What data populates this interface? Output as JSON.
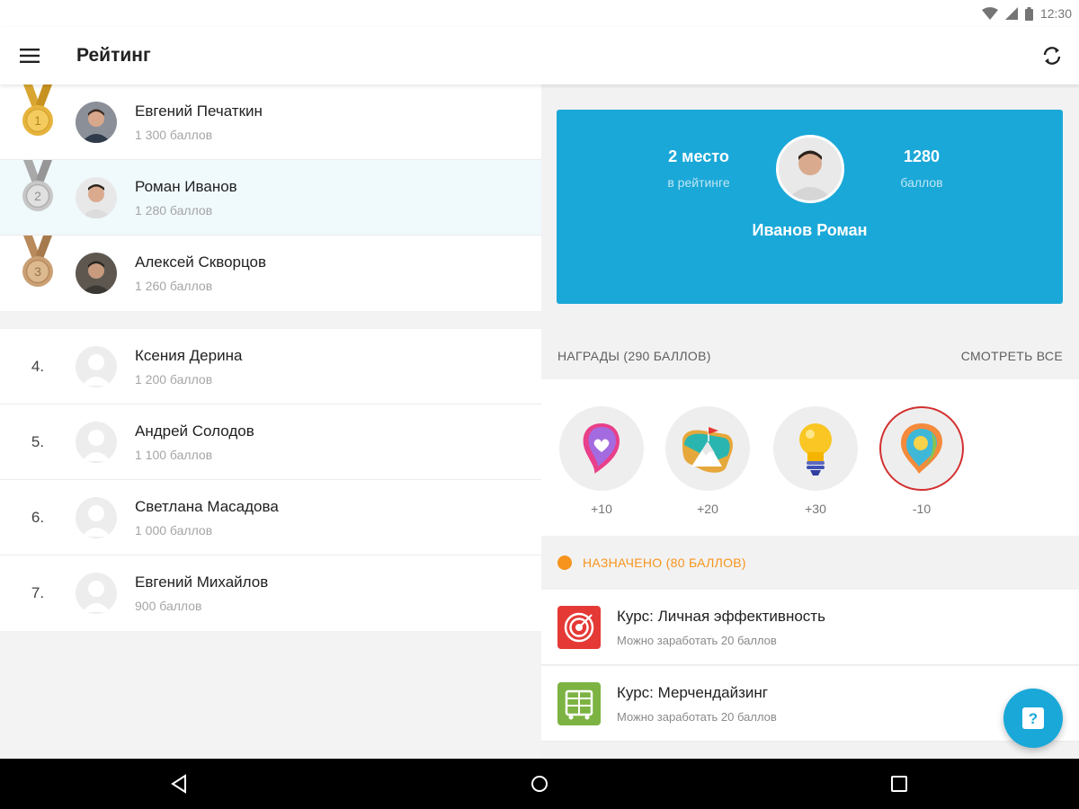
{
  "status_bar": {
    "time": "12:30"
  },
  "app_bar": {
    "title": "Рейтинг"
  },
  "leaderboard": {
    "top": [
      {
        "rank": "1",
        "name": "Евгений Печаткин",
        "score": "1 300 баллов",
        "medal": "gold"
      },
      {
        "rank": "2",
        "name": "Роман Иванов",
        "score": "1 280 баллов",
        "medal": "silver"
      },
      {
        "rank": "3",
        "name": "Алексей Скворцов",
        "score": "1 260 баллов",
        "medal": "bronze"
      }
    ],
    "rest": [
      {
        "rank": "4.",
        "name": "Ксения Дерина",
        "score": "1 200 баллов"
      },
      {
        "rank": "5.",
        "name": "Андрей Солодов",
        "score": "1 100 баллов"
      },
      {
        "rank": "6.",
        "name": "Светлана Масадова",
        "score": "1 000 баллов"
      },
      {
        "rank": "7.",
        "name": "Евгений Михайлов",
        "score": "900 баллов"
      }
    ]
  },
  "profile": {
    "place": "2 место",
    "place_caption": "в рейтинге",
    "points": "1280",
    "points_caption": "баллов",
    "name": "Иванов Роман"
  },
  "awards": {
    "header": "НАГРАДЫ (290 БАЛЛОВ)",
    "see_all": "СМОТРЕТЬ ВСЕ",
    "items": [
      {
        "icon": "heart-pin-icon",
        "points": "+10"
      },
      {
        "icon": "mountain-flag-icon",
        "points": "+20"
      },
      {
        "icon": "lightbulb-icon",
        "points": "+30"
      },
      {
        "icon": "map-pin-icon",
        "points": "-10"
      }
    ]
  },
  "assigned": {
    "header": "НАЗНАЧЕНО (80 БАЛЛОВ)",
    "courses": [
      {
        "title": "Курс: Личная эффективность",
        "subtitle": "Можно заработать 20 баллов",
        "icon": "target-icon",
        "color": "#e53935"
      },
      {
        "title": "Курс: Мерчендайзинг",
        "subtitle": "Можно заработать 20 баллов",
        "icon": "shelf-icon",
        "color": "#7cb342"
      }
    ]
  },
  "colors": {
    "accent": "#1aa8d8",
    "assigned": "#f7941d",
    "gold": "#e6b43c",
    "silver": "#bdbdbd",
    "bronze": "#c9a074"
  }
}
